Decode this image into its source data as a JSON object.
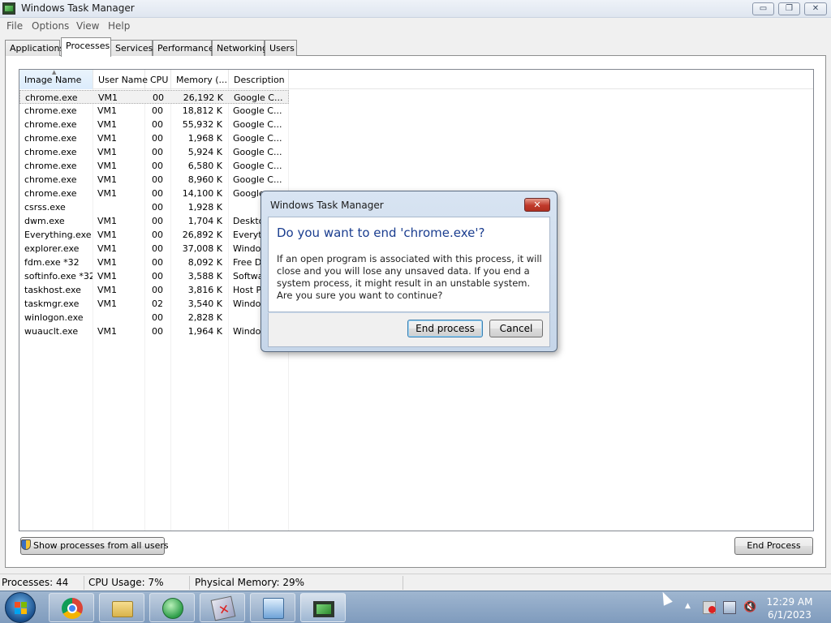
{
  "window": {
    "title": "Windows Task Manager",
    "minimize": "▭",
    "maximize": "❐",
    "close": "✕"
  },
  "menu": [
    "File",
    "Options",
    "View",
    "Help"
  ],
  "tabs": [
    "Applications",
    "Processes",
    "Services",
    "Performance",
    "Networking",
    "Users"
  ],
  "active_tab": "Processes",
  "columns": [
    "Image Name",
    "User Name",
    "CPU",
    "Memory (...",
    "Description"
  ],
  "sorted_column": "Image Name",
  "processes": [
    {
      "name": "chrome.exe",
      "user": "VM1",
      "cpu": "00",
      "mem": "26,192 K",
      "desc": "Google C..."
    },
    {
      "name": "chrome.exe",
      "user": "VM1",
      "cpu": "00",
      "mem": "18,812 K",
      "desc": "Google C..."
    },
    {
      "name": "chrome.exe",
      "user": "VM1",
      "cpu": "00",
      "mem": "55,932 K",
      "desc": "Google C..."
    },
    {
      "name": "chrome.exe",
      "user": "VM1",
      "cpu": "00",
      "mem": "1,968 K",
      "desc": "Google C..."
    },
    {
      "name": "chrome.exe",
      "user": "VM1",
      "cpu": "00",
      "mem": "5,924 K",
      "desc": "Google C..."
    },
    {
      "name": "chrome.exe",
      "user": "VM1",
      "cpu": "00",
      "mem": "6,580 K",
      "desc": "Google C..."
    },
    {
      "name": "chrome.exe",
      "user": "VM1",
      "cpu": "00",
      "mem": "8,960 K",
      "desc": "Google C..."
    },
    {
      "name": "chrome.exe",
      "user": "VM1",
      "cpu": "00",
      "mem": "14,100 K",
      "desc": "Google"
    },
    {
      "name": "csrss.exe",
      "user": "",
      "cpu": "00",
      "mem": "1,928 K",
      "desc": ""
    },
    {
      "name": "dwm.exe",
      "user": "VM1",
      "cpu": "00",
      "mem": "1,704 K",
      "desc": "Deskto"
    },
    {
      "name": "Everything.exe",
      "user": "VM1",
      "cpu": "00",
      "mem": "26,892 K",
      "desc": "Everyth"
    },
    {
      "name": "explorer.exe",
      "user": "VM1",
      "cpu": "00",
      "mem": "37,008 K",
      "desc": "Window"
    },
    {
      "name": "fdm.exe *32",
      "user": "VM1",
      "cpu": "00",
      "mem": "8,092 K",
      "desc": "Free D"
    },
    {
      "name": "softinfo.exe *32",
      "user": "VM1",
      "cpu": "00",
      "mem": "3,588 K",
      "desc": "Softwa"
    },
    {
      "name": "taskhost.exe",
      "user": "VM1",
      "cpu": "00",
      "mem": "3,816 K",
      "desc": "Host Pr"
    },
    {
      "name": "taskmgr.exe",
      "user": "VM1",
      "cpu": "02",
      "mem": "3,540 K",
      "desc": "Window"
    },
    {
      "name": "winlogon.exe",
      "user": "",
      "cpu": "00",
      "mem": "2,828 K",
      "desc": ""
    },
    {
      "name": "wuauclt.exe",
      "user": "VM1",
      "cpu": "00",
      "mem": "1,964 K",
      "desc": "Window"
    }
  ],
  "buttons": {
    "show_all": "Show processes from all users",
    "end_process": "End Process"
  },
  "status": {
    "processes": "Processes: 44",
    "cpu": "CPU Usage: 7%",
    "memory": "Physical Memory: 29%"
  },
  "dialog": {
    "title": "Windows Task Manager",
    "close": "✕",
    "heading": "Do you want to end 'chrome.exe'?",
    "text": "If an open program is associated with this process, it will close and you will lose any unsaved data. If you end a system process, it might result in an unstable system. Are you sure you want to continue?",
    "confirm": "End process",
    "cancel": "Cancel"
  },
  "taskbar": {
    "apps": [
      "chrome-icon",
      "file-explorer-icon",
      "network-globe-icon",
      "disk-tool-icon",
      "control-panel-icon",
      "task-manager-icon"
    ],
    "time": "12:29 AM",
    "date": "6/1/2023"
  },
  "colors": {
    "dialog_heading": "#1a3d8f",
    "taskbar": "#8aa6c6"
  }
}
